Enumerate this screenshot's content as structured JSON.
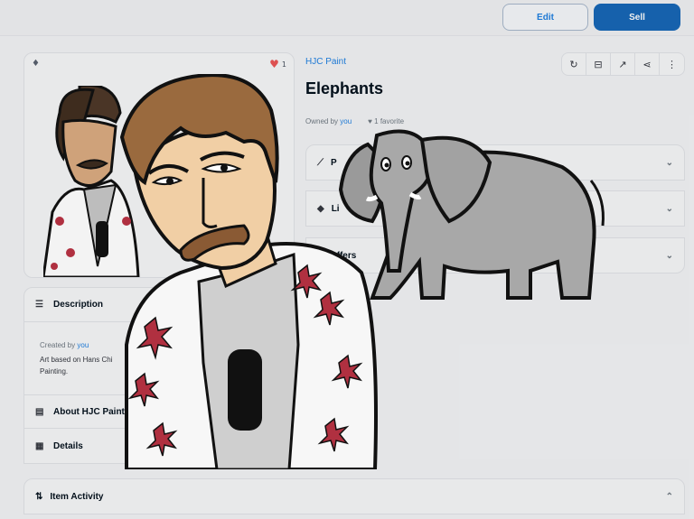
{
  "header": {
    "edit_label": "Edit",
    "sell_label": "Sell"
  },
  "media": {
    "favorites_count": "1"
  },
  "item": {
    "collection": "HJC Paint",
    "title": "Elephants",
    "owned_by_prefix": "Owned by",
    "owner": "you",
    "favorites": "1 favorite"
  },
  "accordions": [
    {
      "label": "P",
      "icon": "price-history-icon"
    },
    {
      "label": "Li",
      "icon": "tag-icon"
    },
    {
      "label": "Offers",
      "icon": "offers-icon"
    }
  ],
  "description": {
    "heading": "Description",
    "created_by_prefix": "Created by",
    "creator": "you",
    "text_line1": "Art based on Hans Chi",
    "text_line2": "Painting."
  },
  "about": {
    "heading": "About HJC Paint"
  },
  "details": {
    "heading": "Details"
  },
  "activity": {
    "heading": "Item Activity"
  }
}
